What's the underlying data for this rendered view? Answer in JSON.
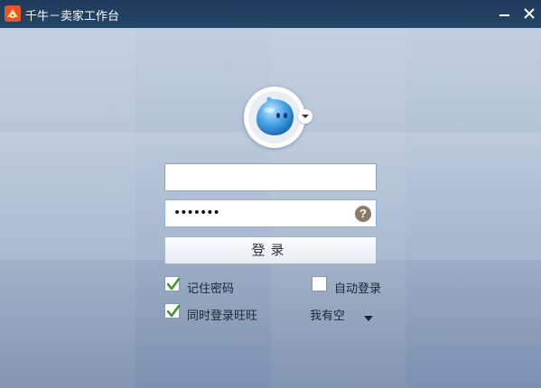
{
  "window": {
    "title": "千牛－卖家工作台",
    "title_bar_color": "#1f3b5c"
  },
  "icons": {
    "app": "qianniu-app-icon",
    "minimize": "minimize-icon",
    "close": "close-icon",
    "avatar": "wangwang-avatar-icon",
    "avatar_dropdown": "chevron-down-icon",
    "help": "help-icon"
  },
  "login": {
    "username_value": "",
    "password_masked": "•••••••",
    "help_glyph": "?",
    "submit_label": "登录"
  },
  "options": {
    "remember_password": {
      "label": "记住密码",
      "checked": true
    },
    "auto_login": {
      "label": "自动登录",
      "checked": false
    },
    "login_wangwang": {
      "label": "同时登录旺旺",
      "checked": true
    },
    "status": {
      "selected": "我有空"
    }
  },
  "colors": {
    "checkmark": "#3f8f2f",
    "help_badge": "#8a7a6a",
    "password_focus": "#7fb4e4"
  }
}
